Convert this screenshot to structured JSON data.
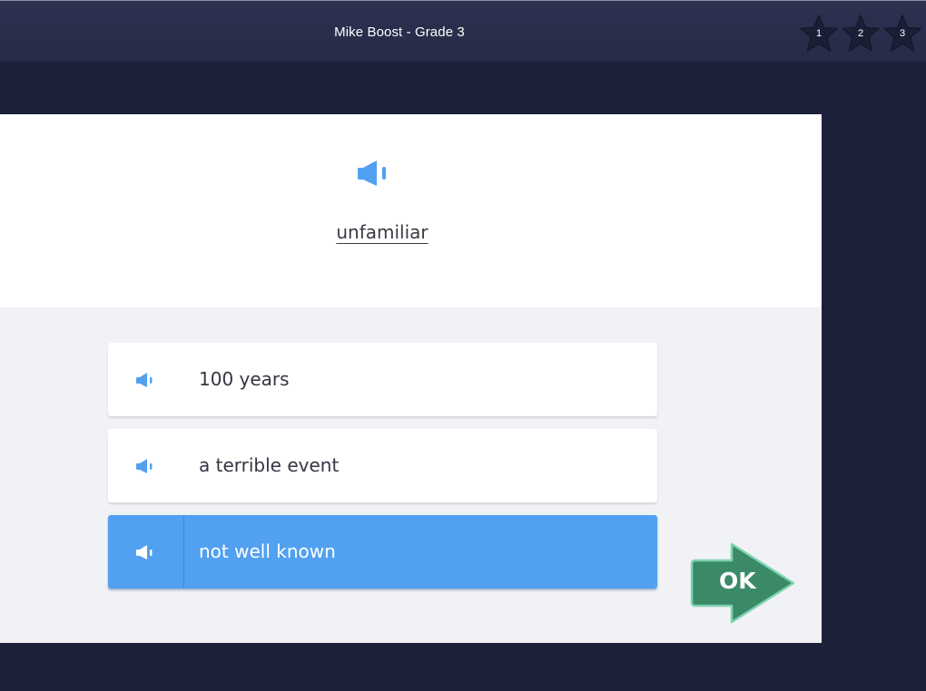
{
  "header": {
    "title": "Mike Boost - Grade 3",
    "stars": [
      {
        "number": "1"
      },
      {
        "number": "2"
      },
      {
        "number": "3"
      }
    ]
  },
  "question": {
    "word": "unfamiliar",
    "audio_icon": "speaker-icon"
  },
  "answers": [
    {
      "text": "100 years",
      "selected": false
    },
    {
      "text": "a terrible event",
      "selected": false
    },
    {
      "text": "not well known",
      "selected": true
    }
  ],
  "ok_button": {
    "label": "OK"
  },
  "colors": {
    "background": "#1c2039",
    "topbar": "#2a2f4c",
    "accent_blue": "#52a0f0",
    "ok_green": "#3a8a68",
    "card_bg": "#f1f2f6"
  }
}
